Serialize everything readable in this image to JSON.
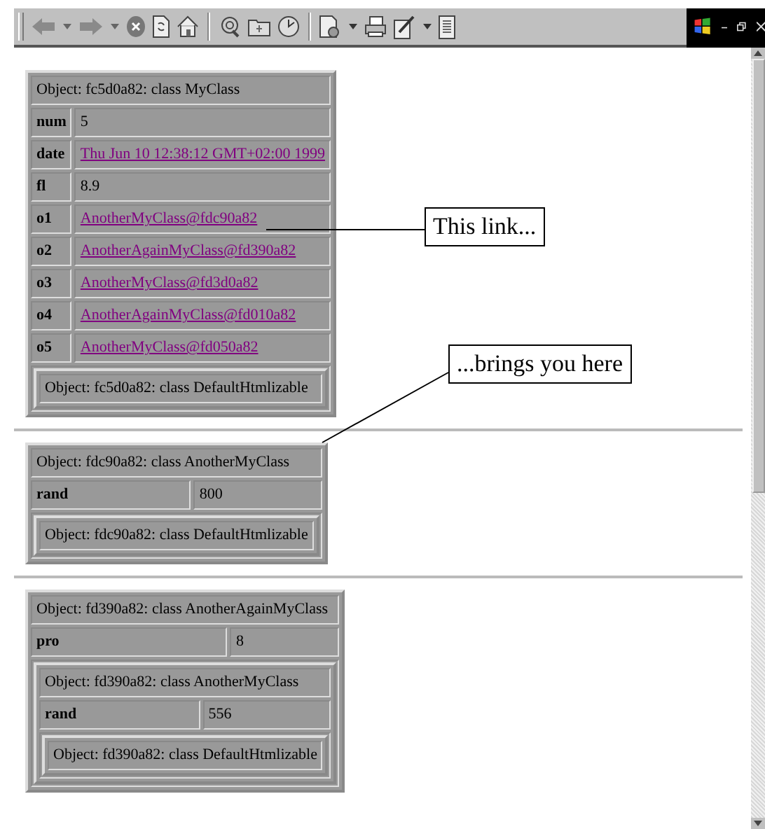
{
  "objects": [
    {
      "header": "Object: fc5d0a82: class MyClass",
      "fields": [
        {
          "name": "num",
          "value": "5",
          "kind": "text"
        },
        {
          "name": "date",
          "value": "Thu Jun 10 12:38:12 GMT+02:00 1999",
          "kind": "link"
        },
        {
          "name": "fl",
          "value": "8.9",
          "kind": "text"
        },
        {
          "name": "o1",
          "value": "AnotherMyClass@fdc90a82",
          "kind": "link"
        },
        {
          "name": "o2",
          "value": "AnotherAgainMyClass@fd390a82",
          "kind": "link"
        },
        {
          "name": "o3",
          "value": "AnotherMyClass@fd3d0a82",
          "kind": "link"
        },
        {
          "name": "o4",
          "value": "AnotherAgainMyClass@fd010a82",
          "kind": "link"
        },
        {
          "name": "o5",
          "value": "AnotherMyClass@fd050a82",
          "kind": "link"
        }
      ],
      "nested": {
        "header": "Object: fc5d0a82: class DefaultHtmlizable"
      }
    },
    {
      "header": "Object: fdc90a82: class AnotherMyClass",
      "fields": [
        {
          "name": "rand",
          "value": "800",
          "kind": "text"
        }
      ],
      "nested": {
        "header": "Object: fdc90a82: class DefaultHtmlizable"
      }
    },
    {
      "header": "Object: fd390a82: class AnotherAgainMyClass",
      "fields": [
        {
          "name": "pro",
          "value": "8",
          "kind": "text"
        }
      ],
      "nested": {
        "header": "Object: fd390a82: class AnotherMyClass",
        "fields": [
          {
            "name": "rand",
            "value": "556",
            "kind": "text"
          }
        ],
        "nested": {
          "header": "Object: fd390a82: class DefaultHtmlizable"
        }
      }
    }
  ],
  "annotations": [
    {
      "text": "This link..."
    },
    {
      "text": "...brings you here"
    }
  ]
}
